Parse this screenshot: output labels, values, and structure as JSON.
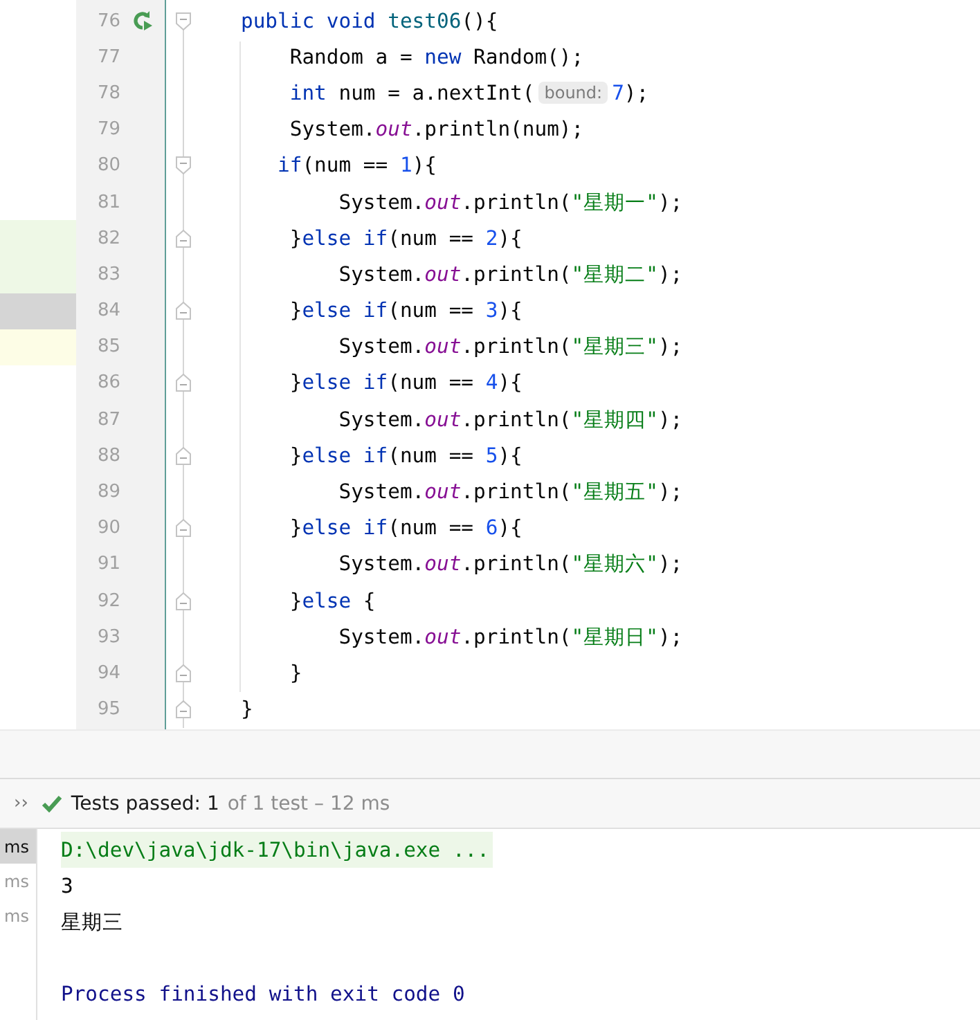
{
  "editor": {
    "lines": [
      {
        "number": "76",
        "run_icon": true,
        "fold_start": true,
        "fold_end": false,
        "tokens": [
          {
            "kind": "keyword",
            "text": "public void "
          },
          {
            "kind": "method",
            "text": "test06"
          },
          {
            "kind": "plain",
            "text": "(){"
          }
        ]
      },
      {
        "number": "77",
        "run_icon": false,
        "fold_start": false,
        "fold_end": false,
        "tokens": [
          {
            "kind": "plain",
            "text": "    Random a = "
          },
          {
            "kind": "keyword",
            "text": "new"
          },
          {
            "kind": "plain",
            "text": " Random();"
          }
        ]
      },
      {
        "number": "78",
        "run_icon": false,
        "fold_start": false,
        "fold_end": false,
        "tokens": [
          {
            "kind": "keyword",
            "text": "    int"
          },
          {
            "kind": "plain",
            "text": " num = a.nextInt("
          },
          {
            "kind": "hint",
            "text": "bound:"
          },
          {
            "kind": "number",
            "text": "7"
          },
          {
            "kind": "plain",
            "text": ");"
          }
        ]
      },
      {
        "number": "79",
        "run_icon": false,
        "fold_start": false,
        "fold_end": false,
        "tokens": [
          {
            "kind": "plain",
            "text": "    System."
          },
          {
            "kind": "field",
            "text": "out"
          },
          {
            "kind": "plain",
            "text": ".println(num);"
          }
        ]
      },
      {
        "number": "80",
        "run_icon": false,
        "fold_start": true,
        "fold_end": false,
        "tokens": [
          {
            "kind": "keyword",
            "text": "   if"
          },
          {
            "kind": "plain",
            "text": "(num == "
          },
          {
            "kind": "number",
            "text": "1"
          },
          {
            "kind": "plain",
            "text": "){"
          }
        ]
      },
      {
        "number": "81",
        "run_icon": false,
        "fold_start": false,
        "fold_end": false,
        "tokens": [
          {
            "kind": "plain",
            "text": "        System."
          },
          {
            "kind": "field",
            "text": "out"
          },
          {
            "kind": "plain",
            "text": ".println("
          },
          {
            "kind": "string",
            "text": "\"星期一\""
          },
          {
            "kind": "plain",
            "text": ");"
          }
        ]
      },
      {
        "number": "82",
        "run_icon": false,
        "fold_start": false,
        "fold_end": true,
        "color": "#eef8e6",
        "tokens": [
          {
            "kind": "plain",
            "text": "    }"
          },
          {
            "kind": "keyword",
            "text": "else if"
          },
          {
            "kind": "plain",
            "text": "(num == "
          },
          {
            "kind": "number",
            "text": "2"
          },
          {
            "kind": "plain",
            "text": "){"
          }
        ]
      },
      {
        "number": "83",
        "run_icon": false,
        "fold_start": false,
        "fold_end": false,
        "color": "#eef8e6",
        "tokens": [
          {
            "kind": "plain",
            "text": "        System."
          },
          {
            "kind": "field",
            "text": "out"
          },
          {
            "kind": "plain",
            "text": ".println("
          },
          {
            "kind": "string",
            "text": "\"星期二\""
          },
          {
            "kind": "plain",
            "text": ");"
          }
        ]
      },
      {
        "number": "84",
        "run_icon": false,
        "fold_start": false,
        "fold_end": true,
        "color": "#d5d5d5",
        "tokens": [
          {
            "kind": "plain",
            "text": "    }"
          },
          {
            "kind": "keyword",
            "text": "else if"
          },
          {
            "kind": "plain",
            "text": "(num == "
          },
          {
            "kind": "number",
            "text": "3"
          },
          {
            "kind": "plain",
            "text": "){"
          }
        ]
      },
      {
        "number": "85",
        "run_icon": false,
        "fold_start": false,
        "fold_end": false,
        "color": "#fdfde6",
        "tokens": [
          {
            "kind": "plain",
            "text": "        System."
          },
          {
            "kind": "field",
            "text": "out"
          },
          {
            "kind": "plain",
            "text": ".println("
          },
          {
            "kind": "string",
            "text": "\"星期三\""
          },
          {
            "kind": "plain",
            "text": ");"
          }
        ]
      },
      {
        "number": "86",
        "run_icon": false,
        "fold_start": false,
        "fold_end": true,
        "tokens": [
          {
            "kind": "plain",
            "text": "    }"
          },
          {
            "kind": "keyword",
            "text": "else if"
          },
          {
            "kind": "plain",
            "text": "(num == "
          },
          {
            "kind": "number",
            "text": "4"
          },
          {
            "kind": "plain",
            "text": "){"
          }
        ]
      },
      {
        "number": "87",
        "run_icon": false,
        "fold_start": false,
        "fold_end": false,
        "tokens": [
          {
            "kind": "plain",
            "text": "        System."
          },
          {
            "kind": "field",
            "text": "out"
          },
          {
            "kind": "plain",
            "text": ".println("
          },
          {
            "kind": "string",
            "text": "\"星期四\""
          },
          {
            "kind": "plain",
            "text": ");"
          }
        ]
      },
      {
        "number": "88",
        "run_icon": false,
        "fold_start": false,
        "fold_end": true,
        "tokens": [
          {
            "kind": "plain",
            "text": "    }"
          },
          {
            "kind": "keyword",
            "text": "else if"
          },
          {
            "kind": "plain",
            "text": "(num == "
          },
          {
            "kind": "number",
            "text": "5"
          },
          {
            "kind": "plain",
            "text": "){"
          }
        ]
      },
      {
        "number": "89",
        "run_icon": false,
        "fold_start": false,
        "fold_end": false,
        "tokens": [
          {
            "kind": "plain",
            "text": "        System."
          },
          {
            "kind": "field",
            "text": "out"
          },
          {
            "kind": "plain",
            "text": ".println("
          },
          {
            "kind": "string",
            "text": "\"星期五\""
          },
          {
            "kind": "plain",
            "text": ");"
          }
        ]
      },
      {
        "number": "90",
        "run_icon": false,
        "fold_start": false,
        "fold_end": true,
        "tokens": [
          {
            "kind": "plain",
            "text": "    }"
          },
          {
            "kind": "keyword",
            "text": "else if"
          },
          {
            "kind": "plain",
            "text": "(num == "
          },
          {
            "kind": "number",
            "text": "6"
          },
          {
            "kind": "plain",
            "text": "){"
          }
        ]
      },
      {
        "number": "91",
        "run_icon": false,
        "fold_start": false,
        "fold_end": false,
        "tokens": [
          {
            "kind": "plain",
            "text": "        System."
          },
          {
            "kind": "field",
            "text": "out"
          },
          {
            "kind": "plain",
            "text": ".println("
          },
          {
            "kind": "string",
            "text": "\"星期六\""
          },
          {
            "kind": "plain",
            "text": ");"
          }
        ]
      },
      {
        "number": "92",
        "run_icon": false,
        "fold_start": false,
        "fold_end": true,
        "tokens": [
          {
            "kind": "plain",
            "text": "    }"
          },
          {
            "kind": "keyword",
            "text": "else"
          },
          {
            "kind": "plain",
            "text": " {"
          }
        ]
      },
      {
        "number": "93",
        "run_icon": false,
        "fold_start": false,
        "fold_end": false,
        "tokens": [
          {
            "kind": "plain",
            "text": "        System."
          },
          {
            "kind": "field",
            "text": "out"
          },
          {
            "kind": "plain",
            "text": ".println("
          },
          {
            "kind": "string",
            "text": "\"星期日\""
          },
          {
            "kind": "plain",
            "text": ");"
          }
        ]
      },
      {
        "number": "94",
        "run_icon": false,
        "fold_start": false,
        "fold_end": true,
        "tokens": [
          {
            "kind": "plain",
            "text": "    }"
          }
        ]
      },
      {
        "number": "95",
        "run_icon": false,
        "fold_start": false,
        "fold_end": true,
        "tokens": [
          {
            "kind": "plain",
            "text": "}"
          }
        ]
      }
    ]
  },
  "test_bar": {
    "expand": "››",
    "passed": true,
    "summary": "Tests passed: 1",
    "detail": "of 1 test – 12 ms"
  },
  "test_list": [
    {
      "label": "ms",
      "selected": true
    },
    {
      "label": "ms",
      "selected": false
    },
    {
      "label": "ms",
      "selected": false
    }
  ],
  "console": [
    {
      "kind": "command",
      "text": "D:\\dev\\java\\jdk-17\\bin\\java.exe ..."
    },
    {
      "kind": "output",
      "text": "3"
    },
    {
      "kind": "output",
      "text": "星期三"
    },
    {
      "kind": "exit",
      "text": "Process finished with exit code 0"
    }
  ]
}
